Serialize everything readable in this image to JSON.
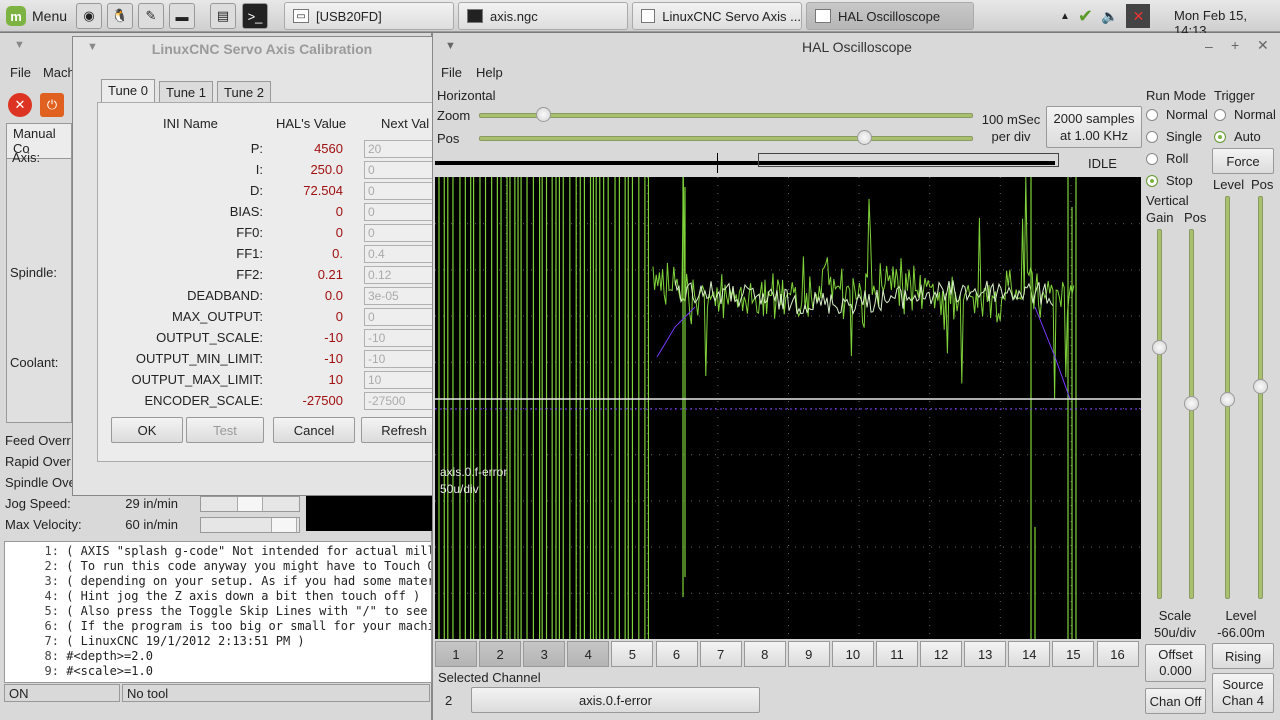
{
  "taskbar": {
    "menu_label": "Menu",
    "tasks": [
      {
        "label": "[USB20FD]"
      },
      {
        "label": "axis.ngc"
      },
      {
        "label": "LinuxCNC Servo Axis ..."
      },
      {
        "label": "HAL Oscilloscope"
      }
    ],
    "clock": "Mon Feb 15, 14:13"
  },
  "axis": {
    "menu": [
      "File",
      "Mach"
    ],
    "tab_manual": "Manual Co",
    "labels": {
      "axis": "Axis:",
      "spindle": "Spindle:",
      "coolant": "Coolant:"
    },
    "overrides": [
      "Feed Overr",
      "Rapid Over",
      "Spindle Ove"
    ],
    "jog_speed_label": "Jog Speed:",
    "jog_speed_value": "29 in/min",
    "max_velocity_label": "Max Velocity:",
    "max_velocity_value": "60 in/min",
    "gcode": [
      {
        "n": "1:",
        "text": "( AXIS \"splash g-code\" Not intended for actual millin"
      },
      {
        "n": "2:",
        "text": "( To run this code anyway you might have to Touch Off"
      },
      {
        "n": "3:",
        "text": "( depending on your setup. As if you had some materia"
      },
      {
        "n": "4:",
        "text": "( Hint jog the Z axis down a bit then touch off )"
      },
      {
        "n": "5:",
        "text": "( Also press the Toggle Skip Lines with \"/\" to see th"
      },
      {
        "n": "6:",
        "text": "( If the program is too big or small for your machine"
      },
      {
        "n": "7:",
        "text": "( LinuxCNC 19/1/2012 2:13:51 PM )"
      },
      {
        "n": "8:",
        "text": "#<depth>=2.0"
      },
      {
        "n": "9:",
        "text": "#<scale>=1.0"
      }
    ],
    "status_on": "ON",
    "status_tool": "No tool"
  },
  "calib": {
    "title": "LinuxCNC Servo Axis Calibration",
    "tabs": [
      "Tune 0",
      "Tune 1",
      "Tune 2"
    ],
    "headers": {
      "ini": "INI Name",
      "hal": "HAL's Value",
      "next": "Next Val"
    },
    "rows": [
      {
        "name": "P:",
        "hal": "4560",
        "next": "20"
      },
      {
        "name": "I:",
        "hal": "250.0",
        "next": "0"
      },
      {
        "name": "D:",
        "hal": "72.504",
        "next": "0"
      },
      {
        "name": "BIAS:",
        "hal": "0",
        "next": "0"
      },
      {
        "name": "FF0:",
        "hal": "0",
        "next": "0"
      },
      {
        "name": "FF1:",
        "hal": "0.",
        "next": "0.4"
      },
      {
        "name": "FF2:",
        "hal": "0.21",
        "next": "0.12"
      },
      {
        "name": "DEADBAND:",
        "hal": "0.0",
        "next": "3e-05"
      },
      {
        "name": "MAX_OUTPUT:",
        "hal": "0",
        "next": "0"
      },
      {
        "name": "OUTPUT_SCALE:",
        "hal": "-10",
        "next": "-10"
      },
      {
        "name": "OUTPUT_MIN_LIMIT:",
        "hal": "-10",
        "next": "-10"
      },
      {
        "name": "OUTPUT_MAX_LIMIT:",
        "hal": "10",
        "next": "10"
      },
      {
        "name": "ENCODER_SCALE:",
        "hal": "-27500",
        "next": "-27500"
      }
    ],
    "buttons": {
      "ok": "OK",
      "test": "Test",
      "cancel": "Cancel",
      "refresh": "Refresh"
    }
  },
  "scope": {
    "title": "HAL Oscilloscope",
    "menu": [
      "File",
      "Help"
    ],
    "horizontal": "Horizontal",
    "zoom_label": "Zoom",
    "pos_label": "Pos",
    "zoom_fraction": 0.12,
    "pos_fraction": 0.79,
    "timebase": "100 mSec",
    "per_div": "per div",
    "samples": "2000 samples",
    "rate": "at 1.00 KHz",
    "state": "IDLE",
    "trace_label_1": "axis.0.f-error",
    "trace_label_2": "50u/div",
    "run_mode": {
      "title": "Run Mode",
      "options": [
        "Normal",
        "Single",
        "Roll",
        "Stop"
      ],
      "selected": "Stop"
    },
    "trigger": {
      "title": "Trigger",
      "options": [
        "Normal",
        "Auto"
      ],
      "selected": "Auto",
      "force": "Force"
    },
    "vertical": {
      "title": "Vertical",
      "gain": "Gain",
      "pos": "Pos"
    },
    "level_pos": {
      "level": "Level",
      "pos": "Pos"
    },
    "scale_label": "Scale",
    "scale_value": "50u/div",
    "level_label": "Level",
    "level_value": "-66.00m",
    "offset_label": "Offset",
    "offset_value": "0.000",
    "rising": "Rising",
    "chan_off": "Chan Off",
    "source_label": "Source",
    "source_value": "Chan 4",
    "channels": [
      "1",
      "2",
      "3",
      "4",
      "5",
      "6",
      "7",
      "8",
      "9",
      "10",
      "11",
      "12",
      "13",
      "14",
      "15",
      "16"
    ],
    "active_channels": [
      "1",
      "2",
      "3",
      "4"
    ],
    "selected_channel_label": "Selected Channel",
    "selected_channel_num": "2",
    "selected_channel_name": "axis.0.f-error"
  },
  "colors": {
    "trace": "#7fd23a",
    "trace_light": "#d8f0c8",
    "purple": "#7a3cff",
    "grid": "#666666"
  }
}
